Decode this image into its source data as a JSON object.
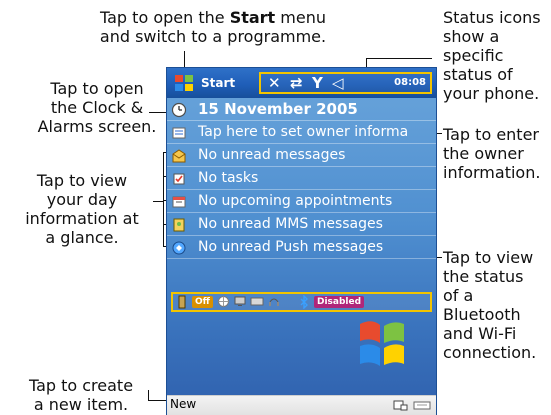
{
  "callouts": {
    "start_prefix": "Tap to open the ",
    "start_keyword": "Start",
    "start_suffix": " menu",
    "start_line2": "and switch to a programme.",
    "status_lines": [
      "Status icons",
      "show a",
      "specific",
      "status of",
      "your phone."
    ],
    "clock_lines": [
      "Tap to open",
      "the Clock &",
      "Alarms screen."
    ],
    "day_lines": [
      "Tap to view",
      "your day",
      "information at",
      "a glance."
    ],
    "owner_lines": [
      "Tap to enter",
      "the owner",
      "information."
    ],
    "bluetooth_lines": [
      "Tap to view",
      "the status",
      "of a",
      "Bluetooth",
      "and Wi-Fi",
      "connection."
    ],
    "new_lines": [
      "Tap to create",
      "a new item."
    ]
  },
  "device": {
    "start_label": "Start",
    "clock": "08:08",
    "status_icons": [
      "signal-settings-icon",
      "sync-arrows-icon",
      "antenna-signal-icon",
      "speaker-volume-icon"
    ],
    "today_items": [
      {
        "icon": "clock-icon",
        "label": "15 November 2005"
      },
      {
        "icon": "owner-card-icon",
        "label": "Tap here to set owner informa"
      },
      {
        "icon": "mail-icon",
        "label": "No unread messages"
      },
      {
        "icon": "task-check-icon",
        "label": "No tasks"
      },
      {
        "icon": "calendar-icon",
        "label": "No upcoming appointments"
      },
      {
        "icon": "mms-icon",
        "label": "No unread MMS messages"
      },
      {
        "icon": "push-icon",
        "label": "No unread Push messages"
      }
    ],
    "connection": {
      "off_label": "Off",
      "disabled_label": "Disabled"
    },
    "new_label": "New"
  },
  "colors": {
    "accent_yellow": "#f2c400",
    "title_blue": "#1f5eb8",
    "today_blue": "#4f8fd0",
    "chip_orange": "#d99000",
    "chip_magenta": "#b0267a"
  }
}
